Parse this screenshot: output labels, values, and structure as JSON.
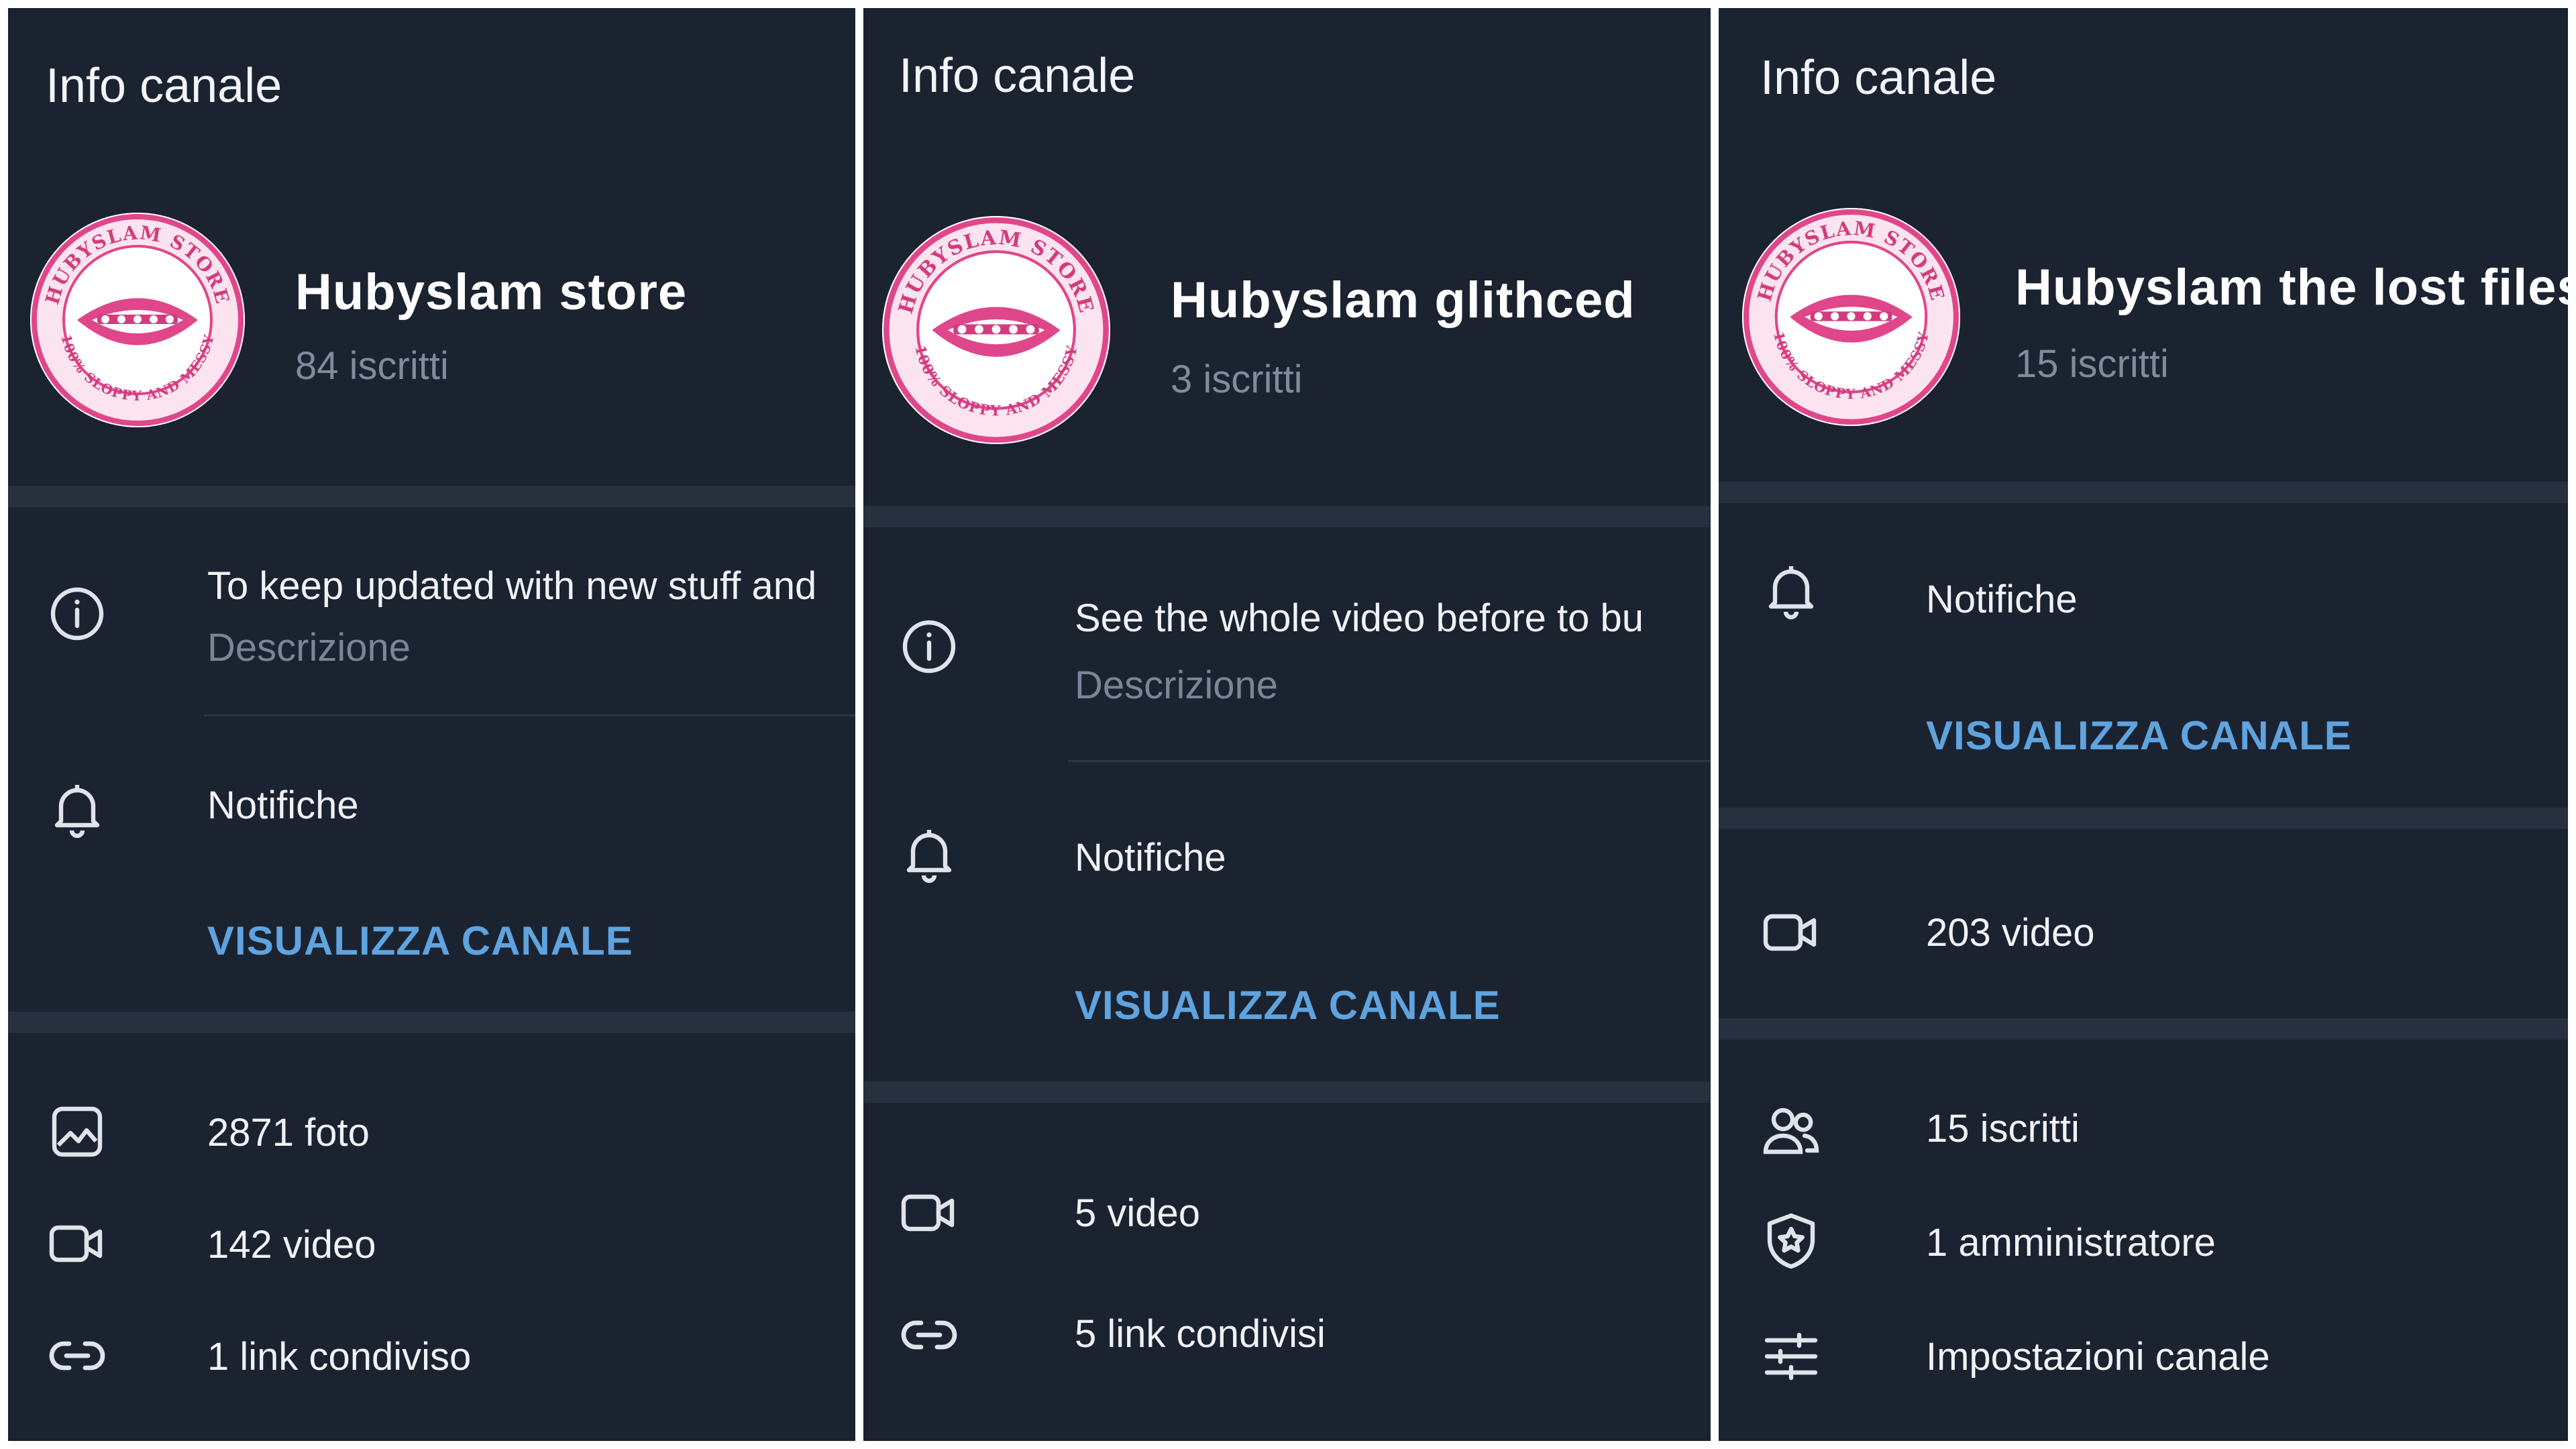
{
  "panels": [
    {
      "header_title": "Info canale",
      "channel_name": "Hubyslam store",
      "subscribers": "84 iscritti",
      "description_text": "To keep updated with new stuff and",
      "description_label": "Descrizione",
      "notifications_label": "Notifiche",
      "view_channel_label": "VISUALIZZA CANALE",
      "photos": "2871 foto",
      "videos": "142 video",
      "links": "1 link condiviso"
    },
    {
      "header_title": "Info canale",
      "channel_name": "Hubyslam glithced",
      "subscribers": "3 iscritti",
      "description_text": "See the whole video before to bu",
      "description_label": "Descrizione",
      "notifications_label": "Notifiche",
      "view_channel_label": "VISUALIZZA CANALE",
      "videos": "5 video",
      "links": "5 link condivisi"
    },
    {
      "header_title": "Info canale",
      "channel_name": "Hubyslam the lost files",
      "subscribers": "15 iscritti",
      "notifications_label": "Notifiche",
      "view_channel_label": "VISUALIZZA CANALE",
      "videos": "203 video",
      "members": "15 iscritti",
      "admins": "1 amministratore",
      "settings": "Impostazioni canale"
    }
  ],
  "avatar": {
    "text_top": "HUBYSLAM STORE",
    "text_bottom": "100% SLOPPY AND MESSY"
  },
  "colors": {
    "panel_bg": "#1b2331",
    "divider": "#26303e",
    "accent_link": "#5fa3df",
    "secondary_text": "#808b9c",
    "logo_pink": "#e0468a"
  },
  "icons": {
    "info": "info-icon",
    "notifications": "bell-icon",
    "photos": "image-icon",
    "videos": "video-camera-icon",
    "links": "link-icon",
    "members": "people-icon",
    "admins": "shield-star-icon",
    "settings": "sliders-icon"
  }
}
